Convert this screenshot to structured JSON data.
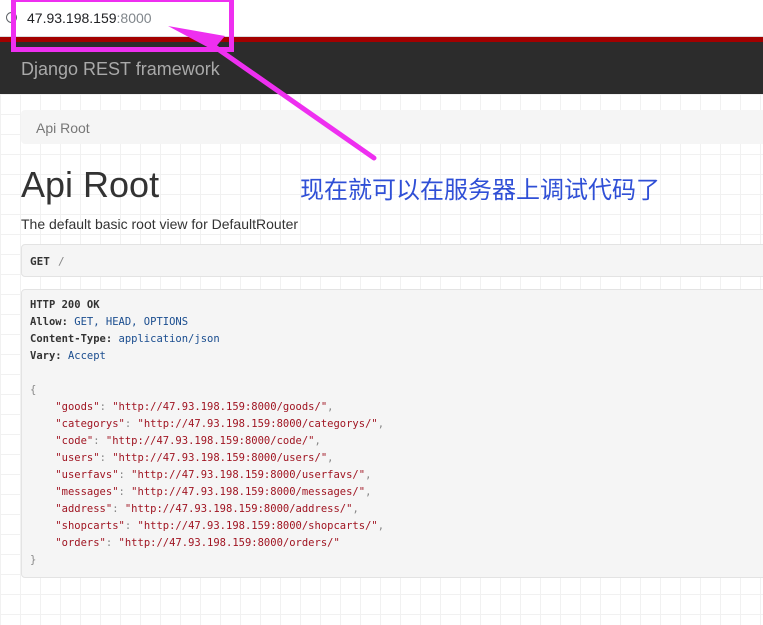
{
  "browser": {
    "url_host": "47.93.198.159",
    "url_port": ":8000",
    "info_icon": "info-icon"
  },
  "navbar": {
    "brand": "Django REST framework"
  },
  "breadcrumb": {
    "item": "Api Root"
  },
  "content": {
    "title": "Api Root",
    "description": "The default basic root view for DefaultRouter",
    "annotation_note": "现在就可以在服务器上调试代码了"
  },
  "request": {
    "method": "GET",
    "path": "/"
  },
  "response": {
    "status": "HTTP 200 OK",
    "headers": [
      {
        "key": "Allow:",
        "value": "GET, HEAD, OPTIONS"
      },
      {
        "key": "Content-Type:",
        "value": "application/json"
      },
      {
        "key": "Vary:",
        "value": "Accept"
      }
    ],
    "open_brace": "{",
    "close_brace": "}",
    "body": [
      {
        "key": "\"goods\"",
        "value": "\"http://47.93.198.159:8000/goods/\"",
        "sep": ","
      },
      {
        "key": "\"categorys\"",
        "value": "\"http://47.93.198.159:8000/categorys/\"",
        "sep": ","
      },
      {
        "key": "\"code\"",
        "value": "\"http://47.93.198.159:8000/code/\"",
        "sep": ","
      },
      {
        "key": "\"users\"",
        "value": "\"http://47.93.198.159:8000/users/\"",
        "sep": ","
      },
      {
        "key": "\"userfavs\"",
        "value": "\"http://47.93.198.159:8000/userfavs/\"",
        "sep": ","
      },
      {
        "key": "\"messages\"",
        "value": "\"http://47.93.198.159:8000/messages/\"",
        "sep": ","
      },
      {
        "key": "\"address\"",
        "value": "\"http://47.93.198.159:8000/address/\"",
        "sep": ","
      },
      {
        "key": "\"shopcarts\"",
        "value": "\"http://47.93.198.159:8000/shopcarts/\"",
        "sep": ","
      },
      {
        "key": "\"orders\"",
        "value": "\"http://47.93.198.159:8000/orders/\"",
        "sep": ""
      }
    ]
  },
  "colors": {
    "annotation": "#ee2ff0",
    "navbar_bg": "#2c2c2c",
    "navbar_accent": "#a30000",
    "note_text": "#2f4fd6",
    "json_string": "#a01522",
    "header_value": "#1a4d8f"
  }
}
